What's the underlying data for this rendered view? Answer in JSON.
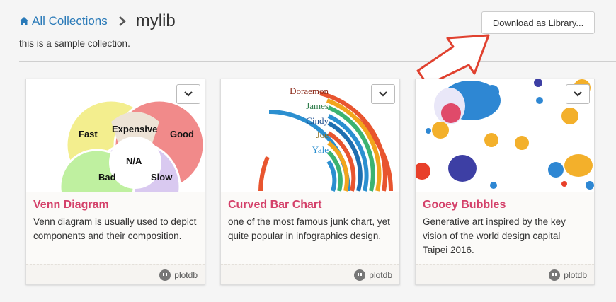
{
  "breadcrumb": {
    "home_label": "All Collections",
    "title": "mylib"
  },
  "description": "this is a sample collection.",
  "download_button": "Download as Library...",
  "cards": [
    {
      "title": "Venn Diagram",
      "description": "Venn diagram is usually used to depict components and their composition.",
      "brand": "plotdb",
      "venn_labels": {
        "a": "Fast",
        "b": "Good",
        "c": "Expensive",
        "d": "N/A",
        "e": "Bad",
        "f": "Slow"
      }
    },
    {
      "title": "Curved Bar Chart",
      "description": "one of the most famous junk chart, yet quite popular in infographics design.",
      "brand": "plotdb",
      "bar_labels": [
        "Doraemon",
        "James",
        "Cindy",
        "Joe",
        "Yale"
      ]
    },
    {
      "title": "Gooey Bubbles",
      "description": "Generative art inspired by the key vision of the world design capital Taipei 2016.",
      "brand": "plotdb"
    }
  ],
  "colors": {
    "link": "#2a7ab8",
    "card_title": "#d4416a",
    "arrow": "#e0412f"
  },
  "icons": {
    "home": "home-icon",
    "chevron": "chevron-right-icon",
    "menu": "chevron-down-icon",
    "brand": "plotdb-logo-icon"
  }
}
